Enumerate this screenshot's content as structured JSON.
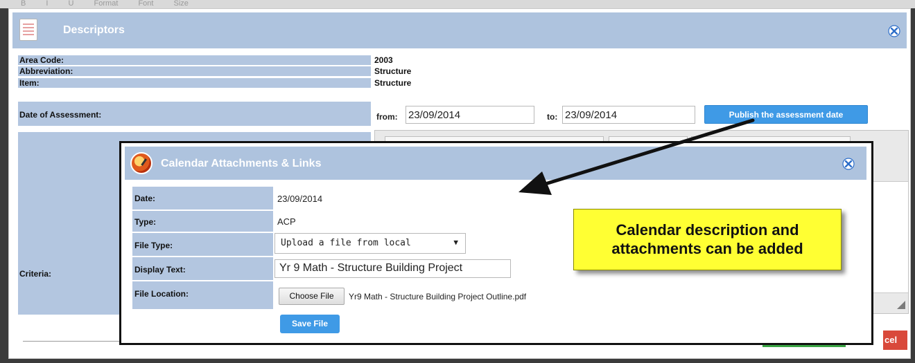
{
  "editor_toolbar": {
    "items": [
      "B",
      "I",
      "U",
      "Format",
      "Font",
      "Size"
    ]
  },
  "descriptors_dialog": {
    "title": "Descriptors",
    "rows": [
      {
        "label": "Area Code:",
        "value": "2003"
      },
      {
        "label": "Abbreviation:",
        "value": "Structure"
      },
      {
        "label": "Item:",
        "value": "Structure"
      }
    ],
    "date_of_assessment": {
      "label": "Date of Assessment:",
      "from_label": "from:",
      "from_value": "23/09/2014",
      "to_label": "to:",
      "to_value": "23/09/2014",
      "publish_button": "Publish the assessment date"
    },
    "criteria_label": "Criteria:",
    "cancel_button_partial": "cel"
  },
  "calendar_dialog": {
    "title": "Calendar Attachments & Links",
    "rows": {
      "date": {
        "label": "Date:",
        "value": "23/09/2014"
      },
      "type": {
        "label": "Type:",
        "value": "ACP"
      },
      "file_type": {
        "label": "File Type:",
        "selected": "Upload a file from local"
      },
      "display_text": {
        "label": "Display Text:",
        "value": "Yr 9 Math - Structure Building Project"
      },
      "file_location": {
        "label": "File Location:",
        "button": "Choose File",
        "file_name": "Yr9 Math - Structure Building Project Outline.pdf"
      }
    },
    "save_button": "Save File"
  },
  "callout": {
    "line1": "Calendar description and",
    "line2": "attachments can be added"
  },
  "colors": {
    "header_blue": "#aec3de",
    "label_blue": "#b3c6e0",
    "button_blue": "#3f9ae6",
    "callout_yellow": "#ffff33",
    "cancel_red": "#d9493b",
    "ok_green": "#3aa544"
  },
  "icons": [
    "document-icon",
    "close-icon",
    "calendar-clock-icon",
    "resize-grip-icon",
    "arrow-annotation"
  ]
}
